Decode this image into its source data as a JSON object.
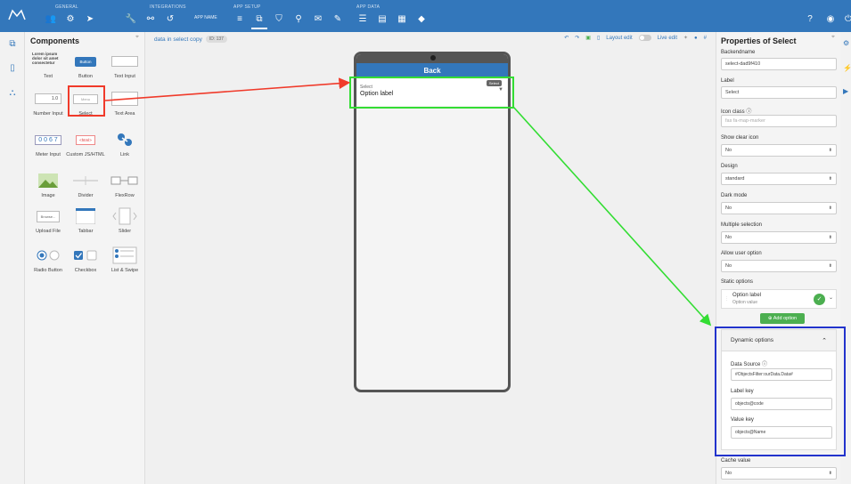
{
  "topbar": {
    "groups": [
      "GENERAL",
      "INTEGRATIONS",
      "APP SETUP",
      "APP DATA"
    ],
    "app_name": "APP NAME",
    "brand_color": "#3377bb"
  },
  "components": {
    "title": "Components",
    "text_preview": "Lorem ipsum dolor sit amet consectetur",
    "button_preview": "Button",
    "number_preview": "1.0",
    "menu_preview": "Menu",
    "meter_preview": "0 0 6 7",
    "html_preview": "<html>",
    "upload_preview": "Browse...",
    "items": [
      "Text",
      "Button",
      "Text Input",
      "Number Input",
      "Select",
      "Text Area",
      "Meter Input",
      "Custom JS/HTML",
      "Link",
      "Image",
      "Divider",
      "FlexRow",
      "Upload File",
      "Tabbar",
      "Slider",
      "Radio Button",
      "Checkbox",
      "List & Swipe"
    ]
  },
  "canvas": {
    "breadcrumb": "data in select copy",
    "id_badge": "ID: 137",
    "layout_edit": "Layout edit",
    "live_edit": "Live edit",
    "phone_header": "Back",
    "select_tag": "Select",
    "select_label": "Select",
    "select_value": "Option label"
  },
  "properties": {
    "title": "Properties of Select",
    "backendname_label": "Backendname",
    "backendname_value": "select-dad9f410",
    "label_label": "Label",
    "label_value": "Select",
    "icon_class_label": "Icon class",
    "icon_class_placeholder": "fas fa-map-marker",
    "show_clear_label": "Show clear icon",
    "show_clear_value": "No",
    "design_label": "Design",
    "design_value": "standard",
    "dark_mode_label": "Dark mode",
    "dark_mode_value": "No",
    "multiple_label": "Multiple selection",
    "multiple_value": "No",
    "allow_user_label": "Allow user option",
    "allow_user_value": "No",
    "static_options_label": "Static options",
    "static_option_label": "Option label",
    "static_option_value": "Option value",
    "add_option": "Add option",
    "dynamic_options_label": "Dynamic options",
    "data_source_label": "Data Source",
    "data_source_value": "#ObjectsFilter:ourData.Data#",
    "label_key_label": "Label key",
    "label_key_value": "objects@code",
    "value_key_label": "Value key",
    "value_key_value": "objects@Name",
    "cache_value_label": "Cache value",
    "cache_value_value": "No"
  },
  "annotations": {
    "red": "#f03a2a",
    "green": "#33dd33",
    "blue": "#2233cc"
  }
}
